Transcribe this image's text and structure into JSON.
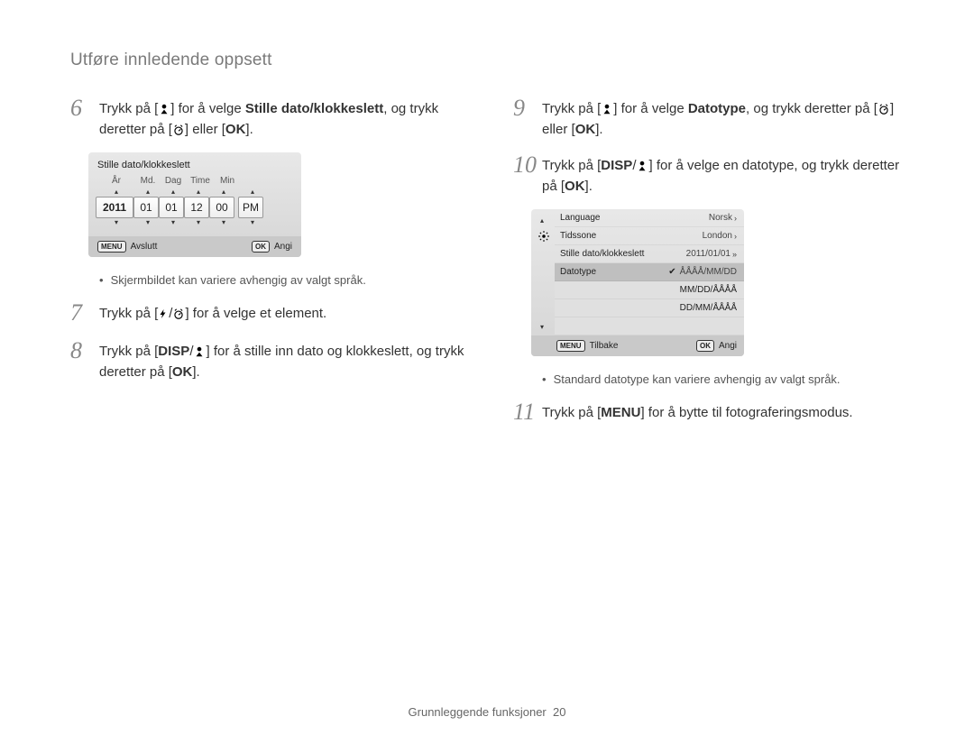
{
  "page": {
    "title": "Utføre innledende oppsett",
    "footer_section": "Grunnleggende funksjoner",
    "footer_page": "20"
  },
  "steps": {
    "s6": {
      "num": "6",
      "t1": "Trykk på [",
      "t2": "] for å velge ",
      "bold1": "Stille dato/klokkeslett",
      "t3": ", og trykk deretter på [",
      "t4": "] eller [",
      "ok": "OK",
      "t5": "]."
    },
    "s7": {
      "num": "7",
      "t1": "Trykk på [",
      "t2": "/",
      "t3": "] for å velge et element."
    },
    "s8": {
      "num": "8",
      "t1": "Trykk på [",
      "disp": "DISP",
      "t2": "/",
      "t3": "] for å stille inn dato og klokkeslett, og trykk deretter på [",
      "ok": "OK",
      "t4": "]."
    },
    "s9": {
      "num": "9",
      "t1": "Trykk på [",
      "t2": "] for å velge ",
      "bold1": "Datotype",
      "t3": ", og trykk deretter på [",
      "t4": "] eller [",
      "ok": "OK",
      "t5": "]."
    },
    "s10": {
      "num": "10",
      "t1": "Trykk på [",
      "disp": "DISP",
      "t2": "/",
      "t3": "] for å velge en datotype, og trykk deretter på [",
      "ok": "OK",
      "t4": "]."
    },
    "s11": {
      "num": "11",
      "t1": "Trykk på [",
      "menu": "MENU",
      "t2": "] for å bytte til fotograferingsmodus."
    }
  },
  "notes": {
    "n1": "Skjermbildet kan variere avhengig av valgt språk.",
    "n2": "Standard datotype kan variere avhengig av valgt språk."
  },
  "fig1": {
    "title": "Stille dato/klokkeslett",
    "labels": {
      "yr": "År",
      "md": "Md.",
      "dg": "Dag",
      "tm": "Time",
      "mn": "Min"
    },
    "values": {
      "yr": "2011",
      "md": "01",
      "dg": "01",
      "tm": "12",
      "mn": "00",
      "pm": "PM"
    },
    "footer": {
      "menu": "MENU",
      "avslutt": "Avslutt",
      "ok": "OK",
      "angi": "Angi"
    }
  },
  "fig2": {
    "rows": [
      {
        "k": "Language",
        "v": "Norsk"
      },
      {
        "k": "Tidssone",
        "v": "London"
      },
      {
        "k": "Stille dato/klokkeslett",
        "v": "2011/01/01"
      },
      {
        "k": "Datotype",
        "v": "ÅÅÅÅ/MM/DD"
      }
    ],
    "options": [
      "ÅÅÅÅ/MM/DD",
      "MM/DD/ÅÅÅÅ",
      "DD/MM/ÅÅÅÅ"
    ],
    "footer": {
      "menu": "MENU",
      "tilbake": "Tilbake",
      "ok": "OK",
      "angi": "Angi"
    }
  }
}
